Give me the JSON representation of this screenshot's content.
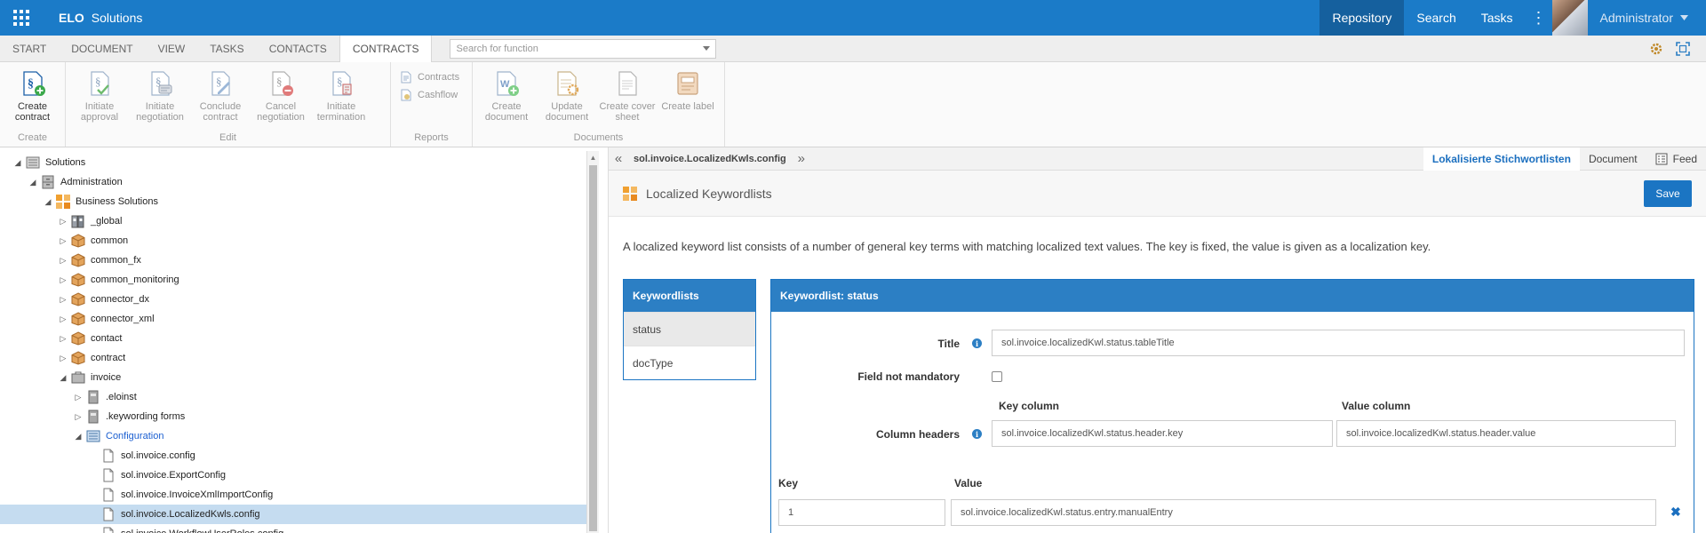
{
  "header": {
    "brand": "ELO",
    "app_name": "Solutions",
    "nav": [
      "Repository",
      "Search",
      "Tasks"
    ],
    "user": "Administrator"
  },
  "tabs": {
    "items": [
      "START",
      "DOCUMENT",
      "VIEW",
      "TASKS",
      "CONTACTS",
      "CONTRACTS"
    ],
    "active": "CONTRACTS",
    "search_placeholder": "Search for function"
  },
  "ribbon": {
    "groups": [
      {
        "label": "Create",
        "buttons": [
          {
            "label": "Create contract",
            "enabled": true
          }
        ]
      },
      {
        "label": "Edit",
        "buttons": [
          {
            "label": "Initiate approval"
          },
          {
            "label": "Initiate negotiation"
          },
          {
            "label": "Conclude contract"
          },
          {
            "label": "Cancel negotiation"
          },
          {
            "label": "Initiate termination"
          }
        ]
      },
      {
        "label": "Reports",
        "small_buttons": [
          "Contracts",
          "Cashflow"
        ]
      },
      {
        "label": "Documents",
        "buttons": [
          {
            "label": "Create document"
          },
          {
            "label": "Update document"
          },
          {
            "label": "Create cover sheet"
          },
          {
            "label": "Create label"
          }
        ]
      }
    ]
  },
  "tree": [
    {
      "label": "Solutions",
      "level": 0,
      "toggle": "open",
      "icon": "repository-icon"
    },
    {
      "label": "Administration",
      "level": 1,
      "toggle": "open",
      "icon": "cabinet-icon"
    },
    {
      "label": "Business Solutions",
      "level": 2,
      "toggle": "open",
      "icon": "solutions-icon"
    },
    {
      "label": "_global",
      "level": 3,
      "toggle": "closed",
      "icon": "binder-icon"
    },
    {
      "label": "common",
      "level": 3,
      "toggle": "closed",
      "icon": "package-icon"
    },
    {
      "label": "common_fx",
      "level": 3,
      "toggle": "closed",
      "icon": "package-icon"
    },
    {
      "label": "common_monitoring",
      "level": 3,
      "toggle": "closed",
      "icon": "package-icon"
    },
    {
      "label": "connector_dx",
      "level": 3,
      "toggle": "closed",
      "icon": "package-icon"
    },
    {
      "label": "connector_xml",
      "level": 3,
      "toggle": "closed",
      "icon": "package-icon"
    },
    {
      "label": "contact",
      "level": 3,
      "toggle": "closed",
      "icon": "package-icon"
    },
    {
      "label": "contract",
      "level": 3,
      "toggle": "closed",
      "icon": "package-icon"
    },
    {
      "label": "invoice",
      "level": 3,
      "toggle": "open",
      "icon": "briefcase-icon"
    },
    {
      "label": ".eloinst",
      "level": 4,
      "toggle": "closed",
      "icon": "binder-gray-icon"
    },
    {
      "label": ".keywording forms",
      "level": 4,
      "toggle": "closed",
      "icon": "binder-gray-icon"
    },
    {
      "label": "Configuration",
      "level": 4,
      "toggle": "open",
      "icon": "config-folder-icon",
      "link": true
    },
    {
      "label": "sol.invoice.config",
      "level": 5,
      "toggle": "",
      "icon": "file-icon"
    },
    {
      "label": "sol.invoice.ExportConfig",
      "level": 5,
      "toggle": "",
      "icon": "file-icon"
    },
    {
      "label": "sol.invoice.InvoiceXmlImportConfig",
      "level": 5,
      "toggle": "",
      "icon": "file-icon"
    },
    {
      "label": "sol.invoice.LocalizedKwls.config",
      "level": 5,
      "toggle": "",
      "icon": "file-icon",
      "selected": true
    },
    {
      "label": "sol.invoice.WorkflowUserRoles.config",
      "level": 5,
      "toggle": "",
      "icon": "file-icon"
    }
  ],
  "document": {
    "name": "sol.invoice.LocalizedKwls.config",
    "right_tabs": [
      "Lokalisierte Stichwortlisten",
      "Document",
      "Feed"
    ],
    "active_tab": "Lokalisierte Stichwortlisten"
  },
  "panel": {
    "title": "Localized Keywordlists",
    "save_label": "Save",
    "description": "A localized keyword list consists of a number of general key terms with matching localized text values. The key is fixed, the value is given as a localization key.",
    "lists_header": "Keywordlists",
    "lists": [
      "status",
      "docType"
    ],
    "active_list": "status",
    "detail": {
      "header": "Keywordlist: status",
      "title_label": "Title",
      "title_value": "sol.invoice.localizedKwl.status.tableTitle",
      "mandatory_label": "Field not mandatory",
      "mandatory_checked": false,
      "column_headers_label": "Column headers",
      "key_column_label": "Key column",
      "value_column_label": "Value column",
      "key_column_value": "sol.invoice.localizedKwl.status.header.key",
      "value_column_value": "sol.invoice.localizedKwl.status.header.value",
      "entries_key_label": "Key",
      "entries_value_label": "Value",
      "entries": [
        {
          "key": "1",
          "value": "sol.invoice.localizedKwl.status.entry.manualEntry"
        }
      ]
    }
  },
  "colors": {
    "header_bg": "#1b7bc8",
    "header_active": "#15609e",
    "accent": "#2c7fc4",
    "selection": "#c5dcf0"
  }
}
